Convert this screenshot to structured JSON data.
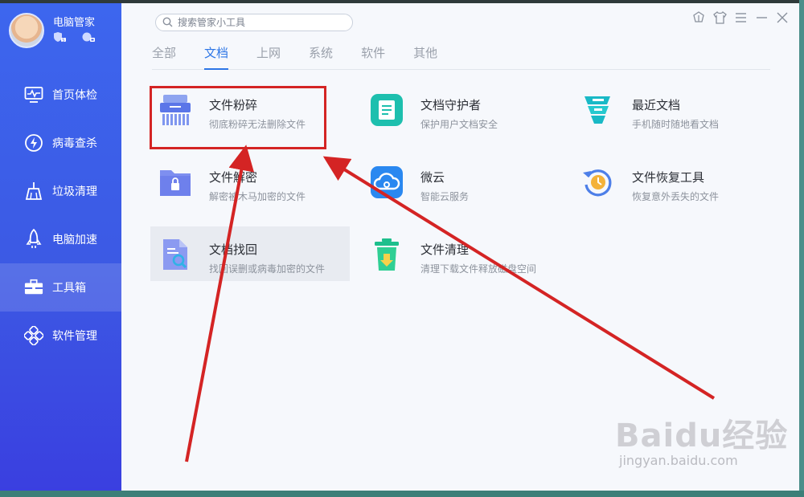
{
  "profile": {
    "name": "电脑管家"
  },
  "search": {
    "placeholder": "搜索管家小工具"
  },
  "sidebar": {
    "items": [
      {
        "label": "首页体检",
        "icon": "monitor-icon"
      },
      {
        "label": "病毒查杀",
        "icon": "lightning-icon"
      },
      {
        "label": "垃圾清理",
        "icon": "broom-icon"
      },
      {
        "label": "电脑加速",
        "icon": "rocket-icon"
      },
      {
        "label": "工具箱",
        "icon": "toolbox-icon",
        "active": true
      },
      {
        "label": "软件管理",
        "icon": "apps-icon"
      }
    ]
  },
  "tabs": [
    {
      "label": "全部"
    },
    {
      "label": "文档",
      "active": true
    },
    {
      "label": "上网"
    },
    {
      "label": "系统"
    },
    {
      "label": "软件"
    },
    {
      "label": "其他"
    }
  ],
  "tools": [
    {
      "name": "文件粉碎",
      "desc": "彻底粉碎无法删除文件",
      "icon": "shredder-icon"
    },
    {
      "name": "文档守护者",
      "desc": "保护用户文档安全",
      "icon": "document-shield-icon"
    },
    {
      "name": "最近文档",
      "desc": "手机随时随地看文档",
      "icon": "recent-docs-icon"
    },
    {
      "name": "文件解密",
      "desc": "解密被木马加密的文件",
      "icon": "folder-lock-icon"
    },
    {
      "name": "微云",
      "desc": "智能云服务",
      "icon": "cloud-icon"
    },
    {
      "name": "文件恢复工具",
      "desc": "恢复意外丢失的文件",
      "icon": "restore-clock-icon"
    },
    {
      "name": "文档找回",
      "desc": "找回误删或病毒加密的文件",
      "icon": "doc-search-icon"
    },
    {
      "name": "文件清理",
      "desc": "清理下载文件释放磁盘空间",
      "icon": "trash-download-icon"
    }
  ],
  "watermark": {
    "main": "Baidu经验",
    "sub": "jingyan.baidu.com"
  },
  "colors": {
    "sidebar": "#3c59e4",
    "accent": "#2d76e6",
    "annotation": "#d42424"
  }
}
